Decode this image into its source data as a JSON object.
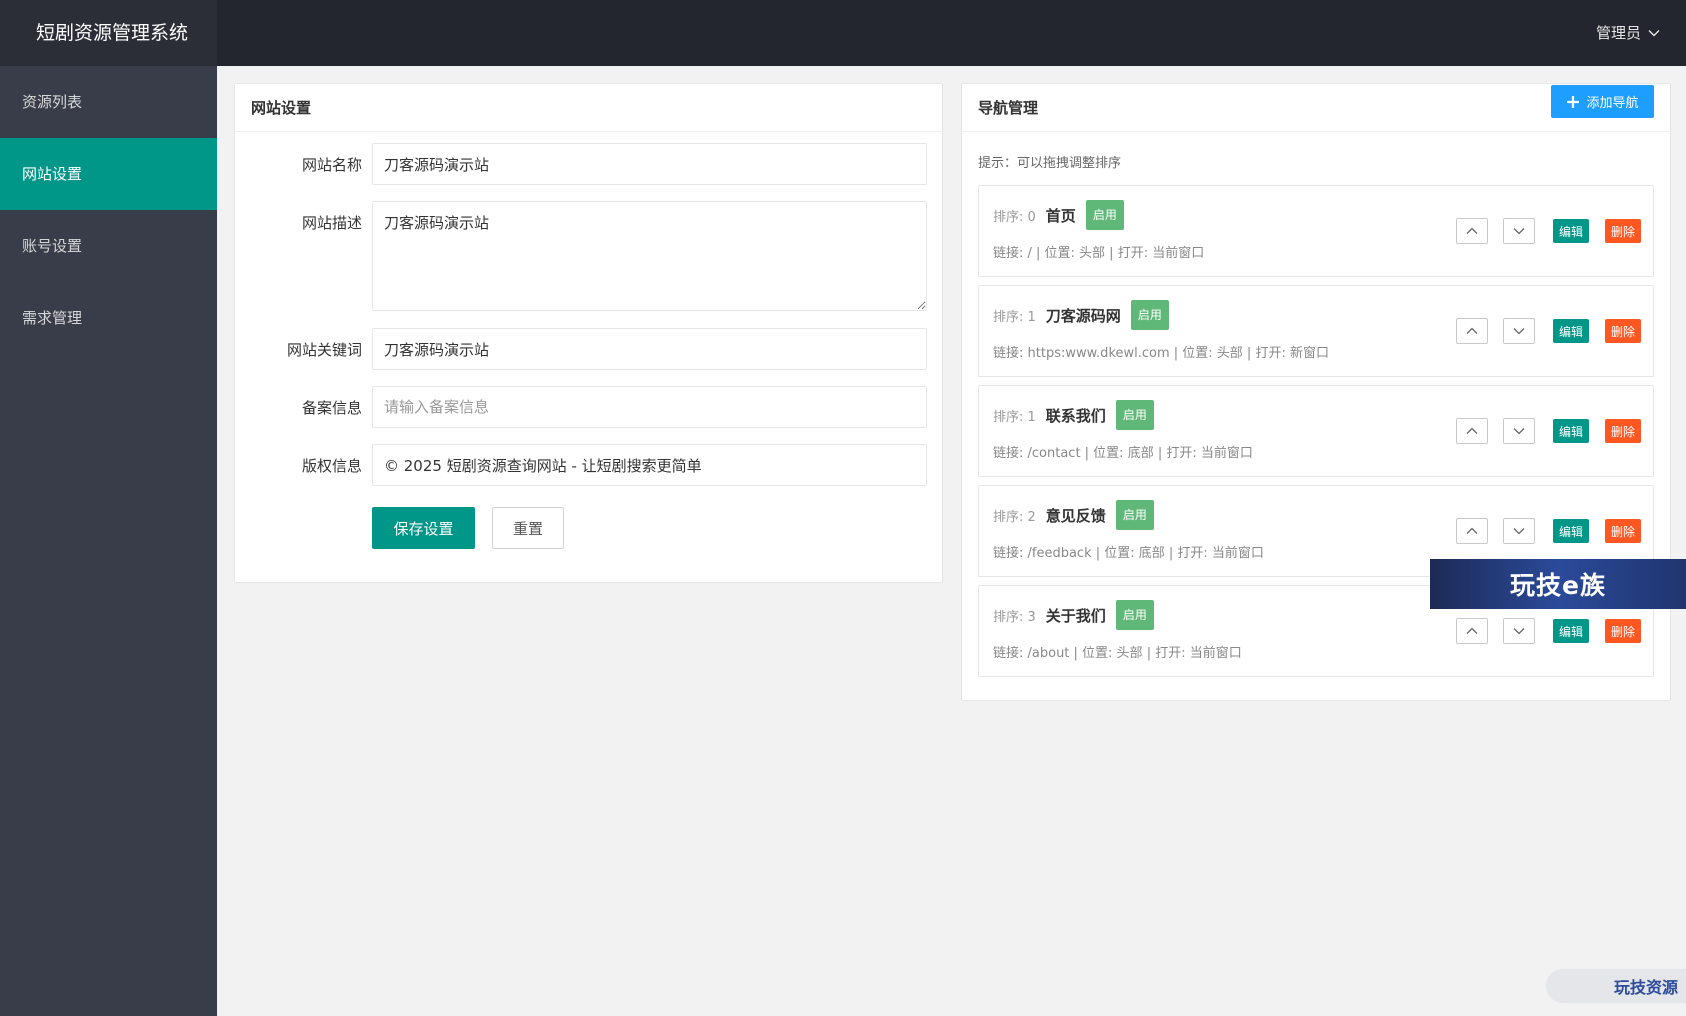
{
  "app": {
    "title": "短剧资源管理系统"
  },
  "sidebar": {
    "items": [
      {
        "label": "资源列表",
        "active": false
      },
      {
        "label": "网站设置",
        "active": true
      },
      {
        "label": "账号设置",
        "active": false
      },
      {
        "label": "需求管理",
        "active": false
      }
    ]
  },
  "header": {
    "user_label": "管理员",
    "user_icon": "chevron-down-icon"
  },
  "settings": {
    "title": "网站设置",
    "fields": {
      "name": {
        "label": "网站名称",
        "value": "刀客源码演示站"
      },
      "description": {
        "label": "网站描述",
        "value": "刀客源码演示站"
      },
      "keywords": {
        "label": "网站关键词",
        "value": "刀客源码演示站"
      },
      "icp": {
        "label": "备案信息",
        "value": "",
        "placeholder": "请输入备案信息"
      },
      "copyright": {
        "label": "版权信息",
        "value": "© 2025 短剧资源查询网站 - 让短剧搜索更简单"
      }
    },
    "save_label": "保存设置",
    "reset_label": "重置"
  },
  "nav_manage": {
    "title": "导航管理",
    "add_label": "添加导航",
    "hint": "提示：可以拖拽调整排序",
    "edit_label": "编辑",
    "delete_label": "删除",
    "status_color": "#5fb878",
    "items": [
      {
        "sort": "排序: 0",
        "name": "首页",
        "status": "启用",
        "meta": "链接: / | 位置: 头部 | 打开: 当前窗口"
      },
      {
        "sort": "排序: 1",
        "name": "刀客源码网",
        "status": "启用",
        "meta": "链接: https:www.dkewl.com | 位置: 头部 | 打开: 新窗口"
      },
      {
        "sort": "排序: 1",
        "name": "联系我们",
        "status": "启用",
        "meta": "链接: /contact | 位置: 底部 | 打开: 当前窗口"
      },
      {
        "sort": "排序: 2",
        "name": "意见反馈",
        "status": "启用",
        "meta": "链接: /feedback | 位置: 底部 | 打开: 当前窗口"
      },
      {
        "sort": "排序: 3",
        "name": "关于我们",
        "status": "启用",
        "meta": "链接: /about | 位置: 头部 | 打开: 当前窗口"
      }
    ]
  },
  "watermarks": {
    "banner": "玩技e族",
    "bottom": "玩技资源"
  },
  "colors": {
    "accent": "#009688",
    "primary_blue": "#1e9fff",
    "danger": "#ff5722",
    "sidebar_bg": "#393d49",
    "header_bg": "#23262e"
  }
}
